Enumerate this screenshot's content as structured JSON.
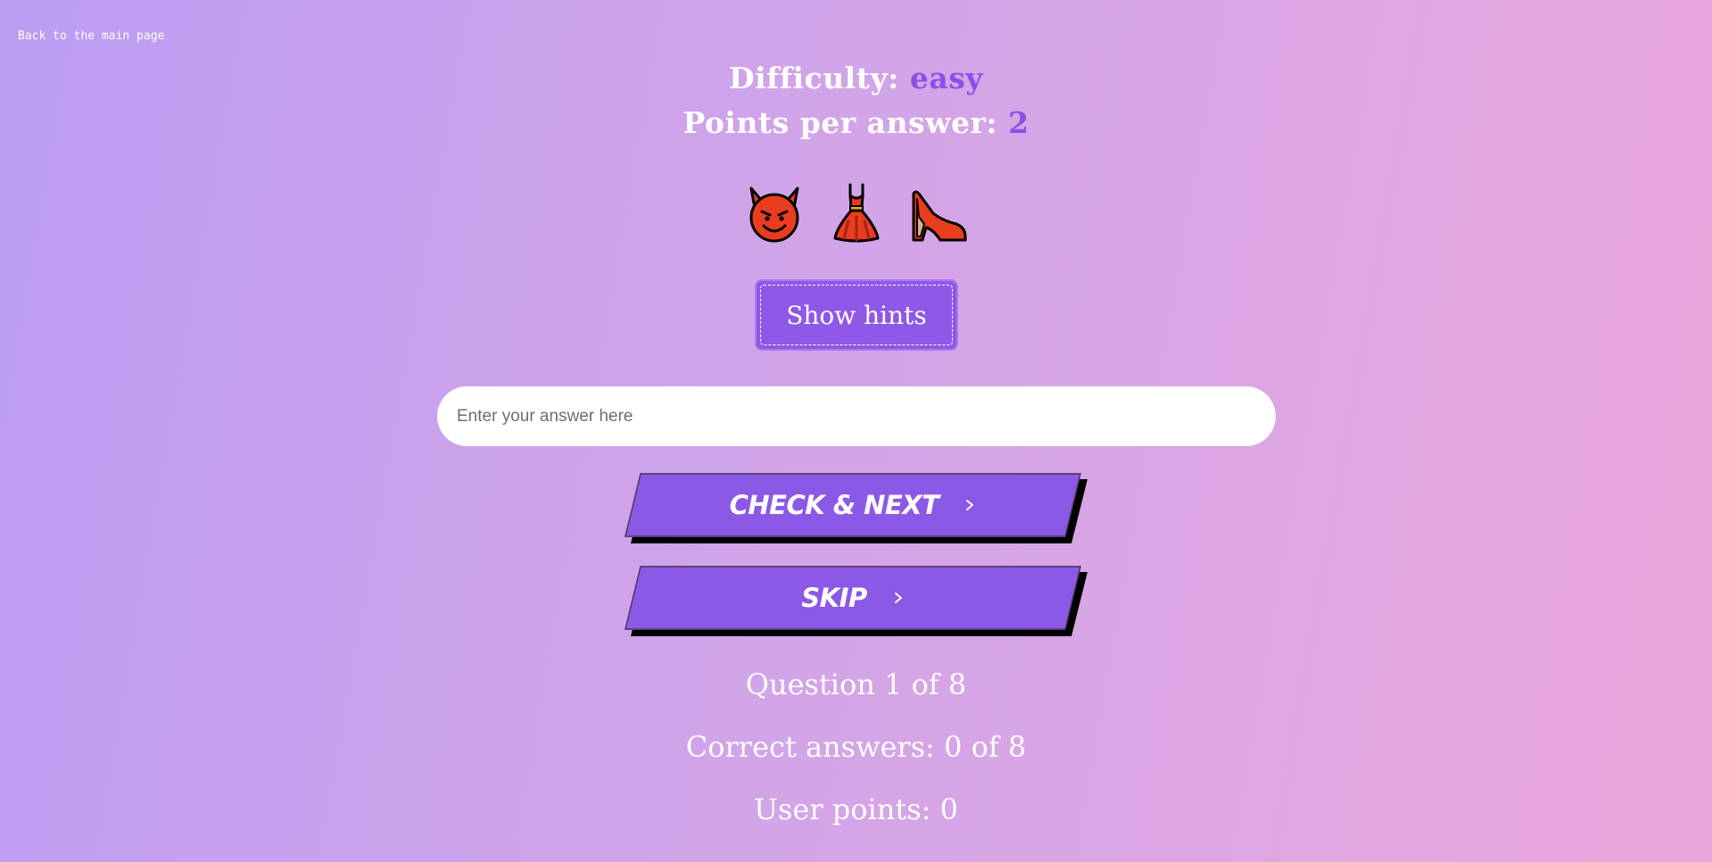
{
  "nav": {
    "back_label": "Back to the main page"
  },
  "quiz": {
    "difficulty_label": "Difficulty:",
    "difficulty_value": "easy",
    "points_label": "Points per answer:",
    "points_value": "2",
    "emojis": [
      {
        "icon": "smiling-devil-icon",
        "glyph": "😈"
      },
      {
        "icon": "red-dress-icon",
        "glyph": "👗"
      },
      {
        "icon": "high-heel-shoe-icon",
        "glyph": "👠"
      }
    ]
  },
  "hints": {
    "button_label": "Show hints"
  },
  "answer": {
    "placeholder": "Enter your answer here",
    "value": ""
  },
  "actions": {
    "check_label": "CHECK & NEXT",
    "skip_label": "SKIP"
  },
  "stats": {
    "question": "Question 1 of 8",
    "correct": "Correct answers: 0 of 8",
    "points": "User points: 0"
  },
  "colors": {
    "accent": "#8b4fe6",
    "button": "#8c58e6",
    "background_start": "#bb9cf3",
    "background_end": "#eaa7dc"
  }
}
